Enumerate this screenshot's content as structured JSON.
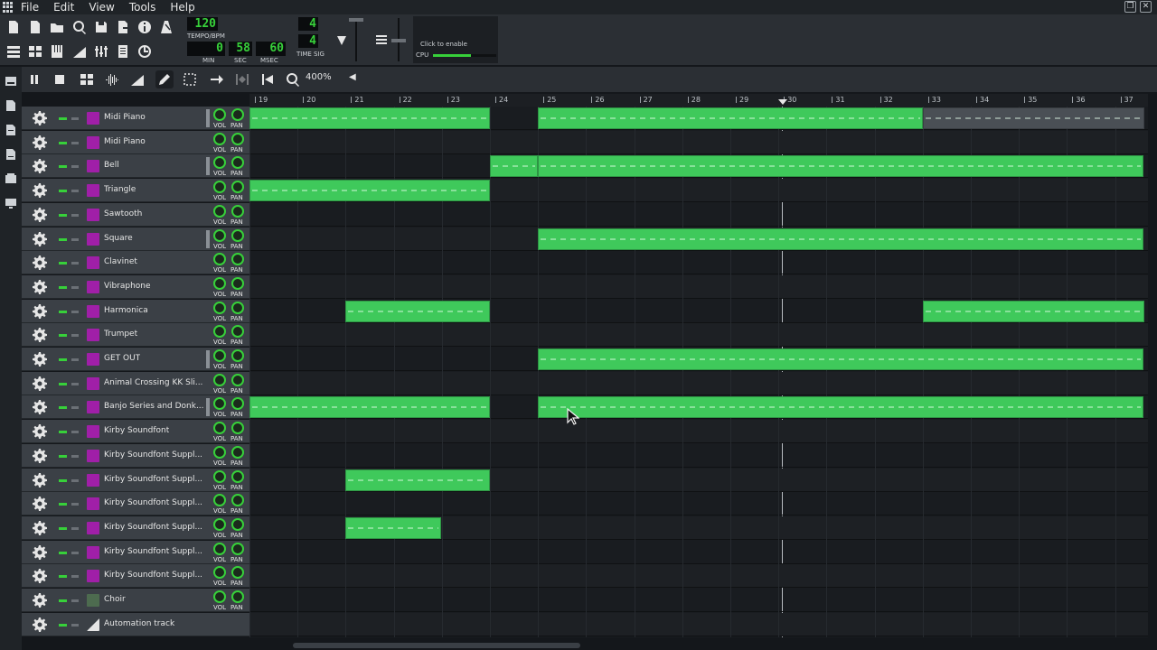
{
  "menubar": {
    "items": [
      "File",
      "Edit",
      "View",
      "Tools",
      "Help"
    ]
  },
  "transport": {
    "tempo_value": "120",
    "tempo_label": "TEMPO/BPM",
    "time_min": "0",
    "time_sec": "58",
    "time_msec": "60",
    "min_label": "MIN",
    "sec_label": "SEC",
    "msec_label": "MSEC",
    "timesig_num": "4",
    "timesig_den": "4",
    "timesig_label": "TIME SIG",
    "cpu_hint": "Click to enable",
    "cpu_label": "CPU"
  },
  "editor_toolbar": {
    "zoom": "400%"
  },
  "ruler": {
    "bars": [
      "19",
      "20",
      "21",
      "22",
      "23",
      "24",
      "25",
      "26",
      "27",
      "28",
      "29",
      "30",
      "31",
      "32",
      "33",
      "34",
      "35",
      "36",
      "37"
    ]
  },
  "knob_labels": {
    "vol": "VOL",
    "pan": "PAN"
  },
  "tracks": [
    {
      "name": "Midi Piano",
      "icon": "instrument-icon"
    },
    {
      "name": "Midi Piano",
      "icon": "instrument-icon"
    },
    {
      "name": "Bell",
      "icon": "instrument-icon"
    },
    {
      "name": "Triangle",
      "icon": "instrument-icon"
    },
    {
      "name": "Sawtooth",
      "icon": "instrument-icon"
    },
    {
      "name": "Square",
      "icon": "instrument-icon"
    },
    {
      "name": "Clavinet",
      "icon": "instrument-icon"
    },
    {
      "name": "Vibraphone",
      "icon": "instrument-icon"
    },
    {
      "name": "Harmonica",
      "icon": "instrument-icon"
    },
    {
      "name": "Trumpet",
      "icon": "instrument-icon"
    },
    {
      "name": "GET OUT",
      "icon": "instrument-icon"
    },
    {
      "name": "Animal Crossing KK Sli...",
      "icon": "instrument-icon"
    },
    {
      "name": "Banjo Series and Donk...",
      "icon": "instrument-icon"
    },
    {
      "name": "Kirby Soundfont",
      "icon": "instrument-icon"
    },
    {
      "name": "Kirby Soundfont Suppl...",
      "icon": "instrument-icon"
    },
    {
      "name": "Kirby Soundfont Suppl...",
      "icon": "instrument-icon"
    },
    {
      "name": "Kirby Soundfont Suppl...",
      "icon": "instrument-icon"
    },
    {
      "name": "Kirby Soundfont Suppl...",
      "icon": "instrument-icon"
    },
    {
      "name": "Kirby Soundfont Suppl...",
      "icon": "instrument-icon"
    },
    {
      "name": "Kirby Soundfont Suppl...",
      "icon": "instrument-icon"
    },
    {
      "name": "Choir",
      "icon": "choir-icon"
    },
    {
      "name": "Automation track",
      "icon": "automation-icon"
    }
  ],
  "colors": {
    "clip_green": "#3fc95b",
    "clip_muted": "#4a4f55",
    "instrument_purple": "#a01fa8",
    "lcd_green": "#37d03a"
  }
}
